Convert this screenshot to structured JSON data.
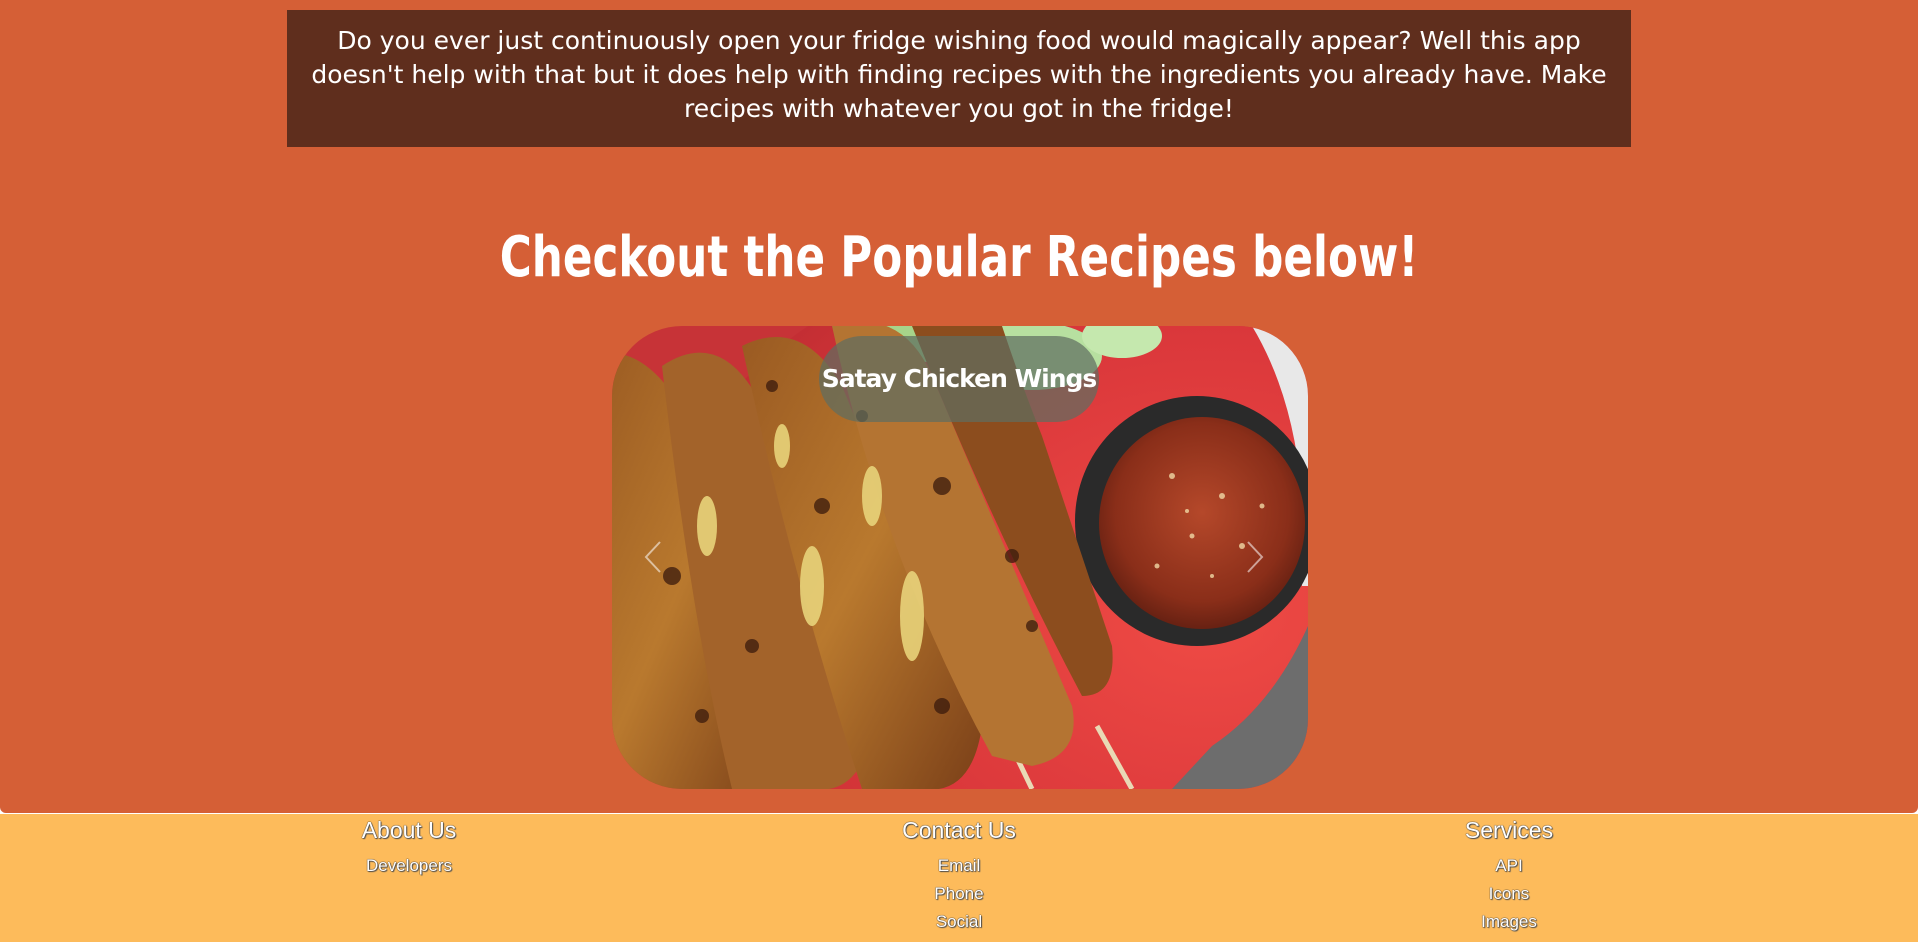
{
  "intro": {
    "text": "Do you ever just continuously open your fridge wishing food would magically appear? Well this app doesn't help with that but it does help with finding recipes with the ingredients you already have. Make recipes with whatever you got in the fridge!"
  },
  "popular": {
    "heading": "Checkout the Popular Recipes below!",
    "carousel": {
      "current_title": "Satay Chicken Wings",
      "prev_icon": "chevron-left-icon",
      "next_icon": "chevron-right-icon"
    }
  },
  "footer": {
    "columns": [
      {
        "heading": "About Us",
        "links": [
          "Developers"
        ]
      },
      {
        "heading": "Contact Us",
        "links": [
          "Email",
          "Phone",
          "Social"
        ]
      },
      {
        "heading": "Services",
        "links": [
          "API",
          "Icons",
          "Images"
        ]
      }
    ]
  },
  "colors": {
    "hero_background": "#d55f36",
    "intro_background": "#5f2e1d",
    "footer_background": "#fdbb5b",
    "text": "#ffffff"
  }
}
